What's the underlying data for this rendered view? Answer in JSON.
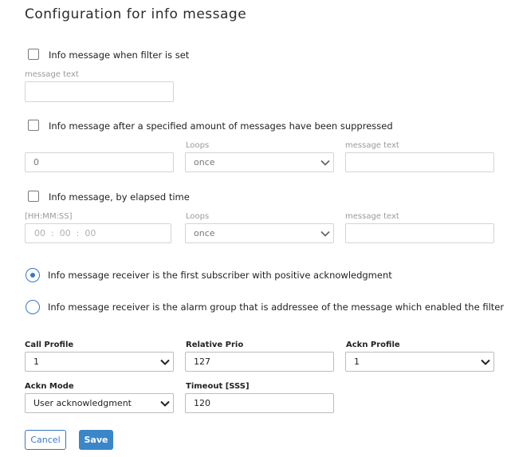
{
  "page_title": "Configuration for info message",
  "section_filter": {
    "checkbox_label": "Info message when filter is set",
    "message_text_label": "message text",
    "message_text_value": ""
  },
  "section_suppressed": {
    "checkbox_label": "Info message after a specified amount of messages have been suppressed",
    "count_value": "0",
    "loops_label": "Loops",
    "loops_value": "once",
    "message_text_label": "message text",
    "message_text_value": ""
  },
  "section_elapsed": {
    "checkbox_label": "Info message, by elapsed time",
    "time_label": "[HH:MM:SS]",
    "time_value": "00  :  00  :  00",
    "loops_label": "Loops",
    "loops_value": "once",
    "message_text_label": "message text",
    "message_text_value": ""
  },
  "receiver": {
    "option_first_subscriber": "Info message receiver is the first subscriber with positive acknowledgment",
    "option_alarm_group": "Info message receiver is the alarm group that is addressee of the message which enabled the filter",
    "selected": "first_subscriber"
  },
  "settings": {
    "call_profile_label": "Call Profile",
    "call_profile_value": "1",
    "relative_prio_label": "Relative Prio",
    "relative_prio_value": "127",
    "ackn_profile_label": "Ackn Profile",
    "ackn_profile_value": "1",
    "ackn_mode_label": "Ackn Mode",
    "ackn_mode_value": "User acknowledgment",
    "timeout_label": "Timeout [SSS]",
    "timeout_value": "120"
  },
  "actions": {
    "cancel_label": "Cancel",
    "save_label": "Save"
  },
  "colors": {
    "accent": "#3a78c2",
    "save_button_bg": "#3a86c8"
  }
}
